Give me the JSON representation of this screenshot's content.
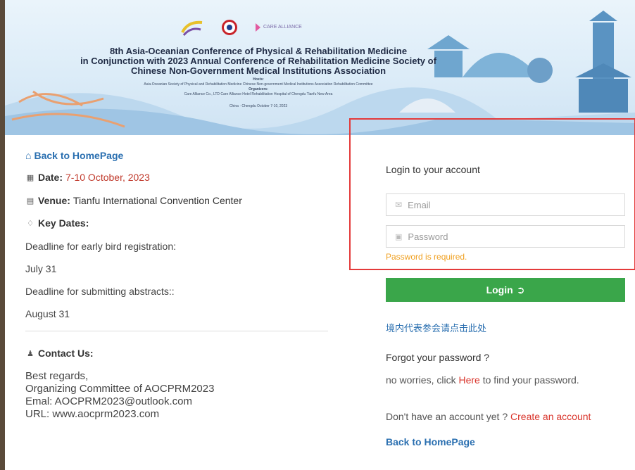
{
  "banner": {
    "logo_c_text": "CARE ALLIANCE",
    "title_line1": "8th Asia-Oceanian Conference of Physical & Rehabilitation Medicine",
    "title_line2": "in Conjunction with 2023 Annual Conference of Rehabilitation Medicine Society of",
    "title_line3": "Chinese Non-Government Medical Institutions Association",
    "hosts_label": "Hosts:",
    "hosts_text": "Asia-Oceanian Society of Physical and Rehabilitation Medicine    Chinese Non-government Medical Institutions Association Rehabilitation Committee",
    "organizers_label": "Organizers:",
    "organizers_text": "Care Alliance Co., LTD    Care Alliance Hotel Rehabilitation Hospital of Chengdu Tianfu New Area",
    "location_date": "China · Chengdu  October 7-10, 2023"
  },
  "left": {
    "back_home": "Back to HomePage",
    "date_label": "Date:",
    "date_value": "7-10 October, 2023",
    "venue_label": "Venue:",
    "venue_value": "Tianfu International Convention Center",
    "key_dates_label": "Key Dates:",
    "early_bird_label": "Deadline for early bird registration:",
    "early_bird_date": "July 31",
    "abstracts_label": "Deadline for submitting abstracts::",
    "abstracts_date": "August 31",
    "contact_label": "Contact Us:",
    "contact_line1": "Best regards,",
    "contact_line2": "Organizing Committee of AOCPRM2023",
    "contact_line3": "Emal: AOCPRM2023@outlook.com",
    "contact_line4": "URL: www.aocprm2023.com"
  },
  "login": {
    "title": "Login to your account",
    "email_placeholder": "Email",
    "password_placeholder": "Password",
    "error": "Password is required.",
    "button": "Login",
    "cn_link": "境内代表参会请点击此处",
    "forgot_title": "Forgot your password ?",
    "forgot_pre": "no worries, click ",
    "forgot_link": "Here",
    "forgot_post": " to find your password.",
    "no_account": "Don't have an account yet ? ",
    "create_link": "Create an account",
    "back_home": "Back to HomePage"
  },
  "colors": {
    "accent_link": "#2a6fb0",
    "error_box": "#e43a3a",
    "login_button": "#3aa64a",
    "error_text": "#f0a020",
    "red_text": "#c0392b"
  }
}
